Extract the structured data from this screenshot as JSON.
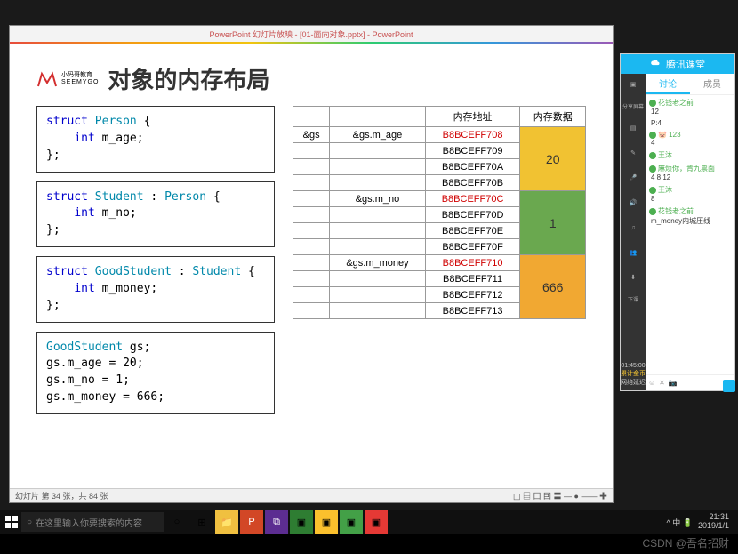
{
  "powerpoint": {
    "titlebar": "PowerPoint 幻灯片放映 - [01-面向对象.pptx] - PowerPoint",
    "slide_title": "对象的内存布局",
    "logo": {
      "cn": "小码哥教育",
      "en": "SEEMYGO"
    },
    "code1": "struct Person {\n    int m_age;\n};",
    "code2": "struct Student : Person {\n    int m_no;\n};",
    "code3": "struct GoodStudent : Student {\n    int m_money;\n};",
    "code4": "GoodStudent gs;\ngs.m_age = 20;\ngs.m_no = 1;\ngs.m_money = 666;",
    "table": {
      "headers": [
        "",
        "",
        "内存地址",
        "内存数据"
      ],
      "rows": [
        {
          "c0": "&gs",
          "c1": "&gs.m_age",
          "addr": "B8BCEFF708",
          "val": "20",
          "vclass": "val20",
          "rowspan": 4,
          "red": true
        },
        {
          "c0": "",
          "c1": "",
          "addr": "B8BCEFF709"
        },
        {
          "c0": "",
          "c1": "",
          "addr": "B8BCEFF70A"
        },
        {
          "c0": "",
          "c1": "",
          "addr": "B8BCEFF70B"
        },
        {
          "c0": "",
          "c1": "&gs.m_no",
          "addr": "B8BCEFF70C",
          "val": "1",
          "vclass": "val1",
          "rowspan": 4,
          "red": true
        },
        {
          "c0": "",
          "c1": "",
          "addr": "B8BCEFF70D"
        },
        {
          "c0": "",
          "c1": "",
          "addr": "B8BCEFF70E"
        },
        {
          "c0": "",
          "c1": "",
          "addr": "B8BCEFF70F"
        },
        {
          "c0": "",
          "c1": "&gs.m_money",
          "addr": "B8BCEFF710",
          "val": "666",
          "vclass": "val666",
          "rowspan": 4,
          "red": true
        },
        {
          "c0": "",
          "c1": "",
          "addr": "B8BCEFF711"
        },
        {
          "c0": "",
          "c1": "",
          "addr": "B8BCEFF712"
        },
        {
          "c0": "",
          "c1": "",
          "addr": "B8BCEFF713"
        }
      ]
    },
    "status": "幻灯片 第 34 张，共 84 张"
  },
  "chat": {
    "brand": "腾讯课堂",
    "tabs": [
      "讨论",
      "成员"
    ],
    "timer": "01:45:00",
    "timer_label1": "累计金币",
    "timer_label2": "网络延迟",
    "messages": [
      {
        "user": "花钱老之前",
        "text": "12"
      },
      {
        "user": "",
        "text": "P:4"
      },
      {
        "user": "🐷 123",
        "text": "4",
        "icon": "pig"
      },
      {
        "user": "王沐",
        "text": ""
      },
      {
        "user": "麻烦你，肯九票面",
        "text": "4 8 12"
      },
      {
        "user": "王沐",
        "text": "8"
      },
      {
        "user": "花钱老之前",
        "text": "m_money内城压线"
      }
    ],
    "input_icons": [
      "☺",
      "✕",
      "📷"
    ],
    "sidebar_label": "分享屏幕",
    "sidebar_dl": "下课"
  },
  "taskbar": {
    "search_placeholder": "在这里输入你要搜索的内容",
    "tray": "^ 中 🔋",
    "time": "21:31",
    "date": "2019/1/1"
  },
  "watermark": "CSDN @吾名招财"
}
